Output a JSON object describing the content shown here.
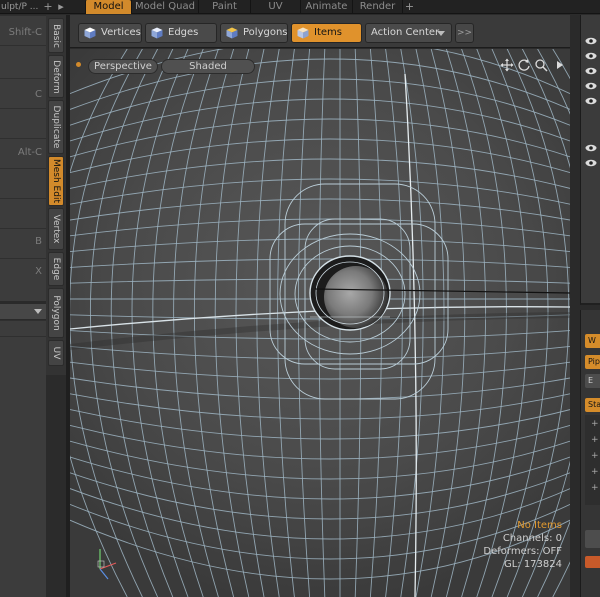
{
  "top_tabs": {
    "left_tab": "ulpt/P ...",
    "plus": "+",
    "items": [
      "Model",
      "Model Quad",
      "Paint",
      "UV",
      "Animate",
      "Render"
    ]
  },
  "left_panel": {
    "shortcuts": [
      "Shift-C",
      "C",
      "Alt-C",
      "B",
      "X"
    ]
  },
  "vertical_tabs": [
    "Basic",
    "Deform",
    "Duplicate",
    "Mesh Edit",
    "Vertex",
    "Edge",
    "Polygon",
    "UV"
  ],
  "toolbar": {
    "vertices": "Vertices",
    "edges": "Edges",
    "polygons": "Polygons",
    "items": "Items",
    "action_center": "Action Center",
    "more": ">>"
  },
  "viewport": {
    "view_label": "Perspective",
    "shading_label": "Shaded",
    "info": {
      "selection": "No Items",
      "channels": "Channels: 0",
      "deformers": "Deformers: OFF",
      "gl": "GL: 173824"
    }
  },
  "right_panel": {
    "mini_buttons": [
      "W",
      "Pip",
      "E",
      "Sta"
    ],
    "list_plus": "+"
  },
  "colors": {
    "accent": "#d28a2b",
    "viewport_bg": "#3d3d3d",
    "wire": "#9fb6c4"
  },
  "icons": [
    "cube-icon",
    "move-icon",
    "rotate-icon",
    "zoom-icon",
    "eye-icon",
    "axis-gizmo-icon"
  ]
}
